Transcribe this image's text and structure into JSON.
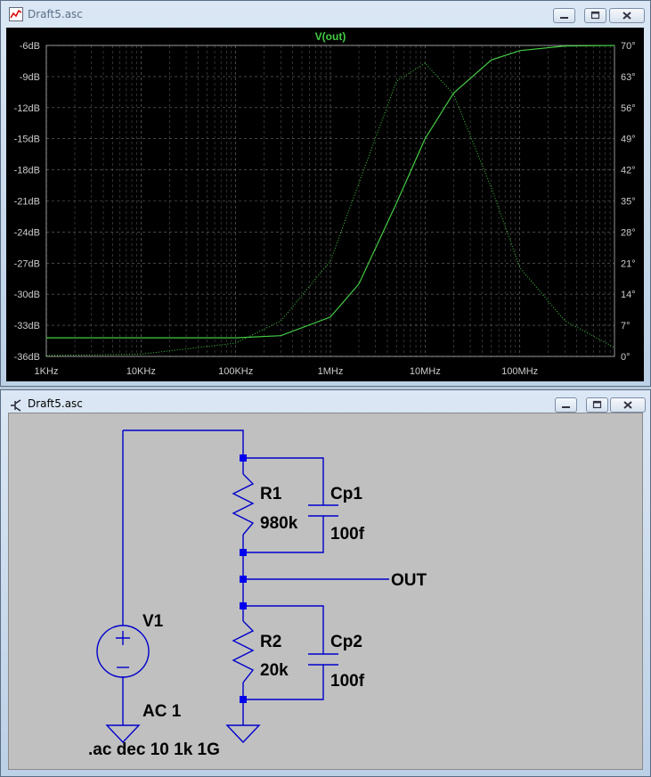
{
  "windows": {
    "waveform": {
      "title": "Draft5.asc"
    },
    "schematic": {
      "title": "Draft5.asc"
    }
  },
  "icons": {
    "waveform_app": "waveform-icon",
    "schematic_app": "transistor-icon",
    "minimize": "minimize-icon",
    "maximize": "maximize-icon",
    "close": "close-icon"
  },
  "colors": {
    "plot_bg": "#000000",
    "trace": "#44cc44",
    "axis_text": "#cccccc",
    "grid": "#888888",
    "wire": "#0000cc",
    "schematic_bg": "#c0c0c0"
  },
  "chart_data": {
    "type": "line",
    "title": "V(out)",
    "x_scale": "log",
    "xlim": [
      1000,
      1000000000
    ],
    "x_ticks": [
      "1KHz",
      "10KHz",
      "100KHz",
      "1MHz",
      "10MHz",
      "100MHz"
    ],
    "y_left_ticks": [
      "-6dB",
      "-9dB",
      "-12dB",
      "-15dB",
      "-18dB",
      "-21dB",
      "-24dB",
      "-27dB",
      "-30dB",
      "-33dB",
      "-36dB"
    ],
    "y_right_ticks": [
      "70°",
      "63°",
      "56°",
      "49°",
      "42°",
      "35°",
      "28°",
      "21°",
      "14°",
      "7°",
      "0°"
    ],
    "ylim_left": [
      -36,
      -6
    ],
    "ylim_right": [
      0,
      70
    ],
    "grid": true,
    "series": [
      {
        "style": "solid",
        "axis": "left",
        "x": [
          1000,
          10000,
          100000,
          300000,
          1000000,
          2000000,
          5000000,
          10000000,
          20000000,
          50000000,
          100000000,
          300000000,
          1000000000
        ],
        "y": [
          -34.2,
          -34.2,
          -34.2,
          -34.0,
          -32.2,
          -29.0,
          -21.2,
          -15.0,
          -10.6,
          -7.4,
          -6.5,
          -6.05,
          -6.0
        ]
      },
      {
        "style": "dotted",
        "axis": "right",
        "x": [
          1000,
          10000,
          100000,
          300000,
          1000000,
          2000000,
          5000000,
          10000000,
          20000000,
          50000000,
          100000000,
          300000000,
          1000000000
        ],
        "y": [
          0.2,
          0.5,
          3,
          8,
          21.5,
          39,
          62,
          66,
          59,
          38,
          20,
          8,
          2
        ]
      }
    ]
  },
  "schematic": {
    "components": [
      {
        "ref": "V1",
        "value": "AC 1"
      },
      {
        "ref": "R1",
        "value": "980k"
      },
      {
        "ref": "Cp1",
        "value": "100f"
      },
      {
        "ref": "R2",
        "value": "20k"
      },
      {
        "ref": "Cp2",
        "value": "100f"
      }
    ],
    "net_label": "OUT",
    "directive": ".ac dec 10 1k 1G"
  }
}
